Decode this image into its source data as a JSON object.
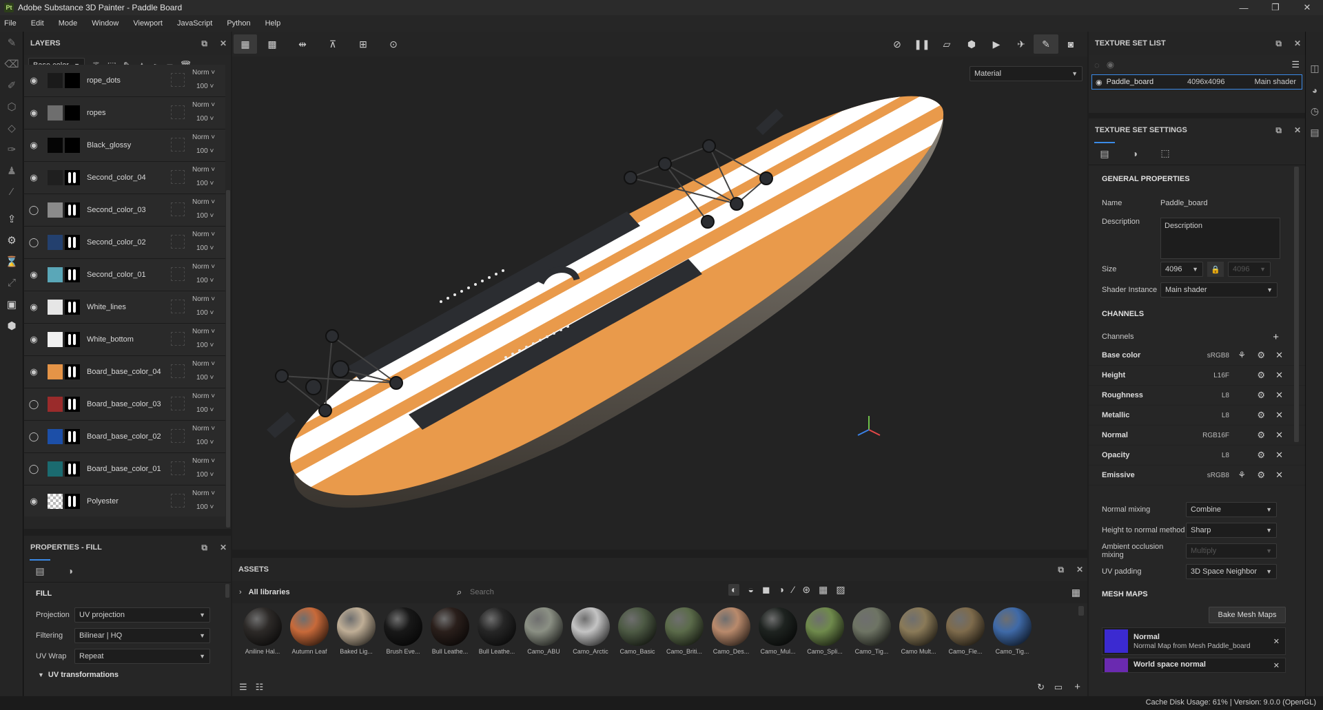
{
  "window": {
    "title": "Adobe Substance 3D Painter - Paddle Board",
    "app_icon": "Pt",
    "ctrl_min": "—",
    "ctrl_max": "❐",
    "ctrl_close": "✕"
  },
  "menu": [
    "File",
    "Edit",
    "Mode",
    "Window",
    "Viewport",
    "JavaScript",
    "Python",
    "Help"
  ],
  "layers": {
    "title": "LAYERS",
    "channel_select": "Base color",
    "items": [
      {
        "name": "rope_dots",
        "blend": "Norm",
        "opacity": "100",
        "thumb": "#1a1a1a",
        "mask": "black",
        "visible": true
      },
      {
        "name": "ropes",
        "blend": "Norm",
        "opacity": "100",
        "thumb": "#6e6e6e",
        "mask": "black",
        "visible": true
      },
      {
        "name": "Black_glossy",
        "blend": "Norm",
        "opacity": "100",
        "thumb": "#050505",
        "mask": "black",
        "visible": true
      },
      {
        "name": "Second_color_04",
        "blend": "Norm",
        "opacity": "100",
        "thumb": "#1f1f1f",
        "mask": "white",
        "visible": true
      },
      {
        "name": "Second_color_03",
        "blend": "Norm",
        "opacity": "100",
        "thumb": "#8a8a8a",
        "mask": "white",
        "visible": false
      },
      {
        "name": "Second_color_02",
        "blend": "Norm",
        "opacity": "100",
        "thumb": "#23406e",
        "mask": "white",
        "visible": false
      },
      {
        "name": "Second_color_01",
        "blend": "Norm",
        "opacity": "100",
        "thumb": "#5aa7b8",
        "mask": "white",
        "visible": true
      },
      {
        "name": "White_lines",
        "blend": "Norm",
        "opacity": "100",
        "thumb": "#e6e6e6",
        "mask": "white",
        "visible": true
      },
      {
        "name": "White_bottom",
        "blend": "Norm",
        "opacity": "100",
        "thumb": "#f0f0f0",
        "mask": "white",
        "visible": true
      },
      {
        "name": "Board_base_color_04",
        "blend": "Norm",
        "opacity": "100",
        "thumb": "#e59447",
        "mask": "white",
        "visible": true
      },
      {
        "name": "Board_base_color_03",
        "blend": "Norm",
        "opacity": "100",
        "thumb": "#9a2b2b",
        "mask": "white",
        "visible": false
      },
      {
        "name": "Board_base_color_02",
        "blend": "Norm",
        "opacity": "100",
        "thumb": "#1c4fa8",
        "mask": "white",
        "visible": false
      },
      {
        "name": "Board_base_color_01",
        "blend": "Norm",
        "opacity": "100",
        "thumb": "#1b6b70",
        "mask": "white",
        "visible": false
      },
      {
        "name": "Polyester",
        "blend": "Norm",
        "opacity": "100",
        "thumb": "checker",
        "mask": "white",
        "visible": true
      }
    ]
  },
  "properties": {
    "title": "PROPERTIES - FILL",
    "section": "FILL",
    "projection_label": "Projection",
    "projection_value": "UV projection",
    "filtering_label": "Filtering",
    "filtering_value": "Bilinear | HQ",
    "uvwrap_label": "UV Wrap",
    "uvwrap_value": "Repeat",
    "uvtransform_label": "UV transformations"
  },
  "viewport": {
    "material_select": "Material"
  },
  "assets": {
    "title": "ASSETS",
    "library": "All libraries",
    "search_placeholder": "Search",
    "items": [
      {
        "label": "Aniline Hal...",
        "color": "#2d2a28"
      },
      {
        "label": "Autumn Leaf",
        "color": "#c86a3a"
      },
      {
        "label": "Baked Lig...",
        "color": "#bfae96"
      },
      {
        "label": "Brush Eve...",
        "color": "#181818"
      },
      {
        "label": "Bull Leathe...",
        "color": "#2a1f1b"
      },
      {
        "label": "Bull Leathe...",
        "color": "#262626"
      },
      {
        "label": "Camo_ABU",
        "color": "#8b9084"
      },
      {
        "label": "Camo_Arctic",
        "color": "#c4c4c4"
      },
      {
        "label": "Camo_Basic",
        "color": "#4d5a44"
      },
      {
        "label": "Camo_Briti...",
        "color": "#5b6b4a"
      },
      {
        "label": "Camo_Des...",
        "color": "#b98a6c"
      },
      {
        "label": "Camo_Mul...",
        "color": "#1e2320"
      },
      {
        "label": "Camo_Spli...",
        "color": "#6f8a4c"
      },
      {
        "label": "Camo_Tig...",
        "color": "#6e7464"
      },
      {
        "label": "Camo Mult...",
        "color": "#8a7a58"
      },
      {
        "label": "Camo_Fle...",
        "color": "#7e6b4c"
      },
      {
        "label": "Camo_Tig...",
        "color": "#3f6aa8"
      }
    ]
  },
  "texture_set_list": {
    "title": "TEXTURE SET LIST",
    "name": "Paddle_board",
    "size": "4096x4096",
    "shader": "Main shader"
  },
  "texture_set_settings": {
    "title": "TEXTURE SET SETTINGS",
    "general_title": "GENERAL PROPERTIES",
    "name_label": "Name",
    "name_value": "Paddle_board",
    "desc_label": "Description",
    "desc_value": "Description",
    "size_label": "Size",
    "size_value": "4096",
    "size_value2": "4096",
    "shader_label": "Shader Instance",
    "shader_value": "Main shader",
    "channels_title": "CHANNELS",
    "channels_label": "Channels",
    "channels": [
      {
        "name": "Base color",
        "format": "sRGB8"
      },
      {
        "name": "Height",
        "format": "L16F"
      },
      {
        "name": "Roughness",
        "format": "L8"
      },
      {
        "name": "Metallic",
        "format": "L8"
      },
      {
        "name": "Normal",
        "format": "RGB16F"
      },
      {
        "name": "Opacity",
        "format": "L8"
      },
      {
        "name": "Emissive",
        "format": "sRGB8"
      }
    ],
    "normal_mixing_label": "Normal mixing",
    "normal_mixing_value": "Combine",
    "h2n_label": "Height to normal method",
    "h2n_value": "Sharp",
    "ao_label": "Ambient occlusion mixing",
    "ao_value": "Multiply",
    "uvpad_label": "UV padding",
    "uvpad_value": "3D Space Neighbor",
    "mesh_maps_title": "MESH MAPS",
    "bake_button": "Bake Mesh Maps",
    "mesh_maps": [
      {
        "title": "Normal",
        "sub": "Normal Map from Mesh Paddle_board"
      },
      {
        "title": "World space normal",
        "sub": ""
      }
    ]
  },
  "status": {
    "text": "Cache Disk Usage:   61% | Version: 9.0.0 (OpenGL)"
  }
}
